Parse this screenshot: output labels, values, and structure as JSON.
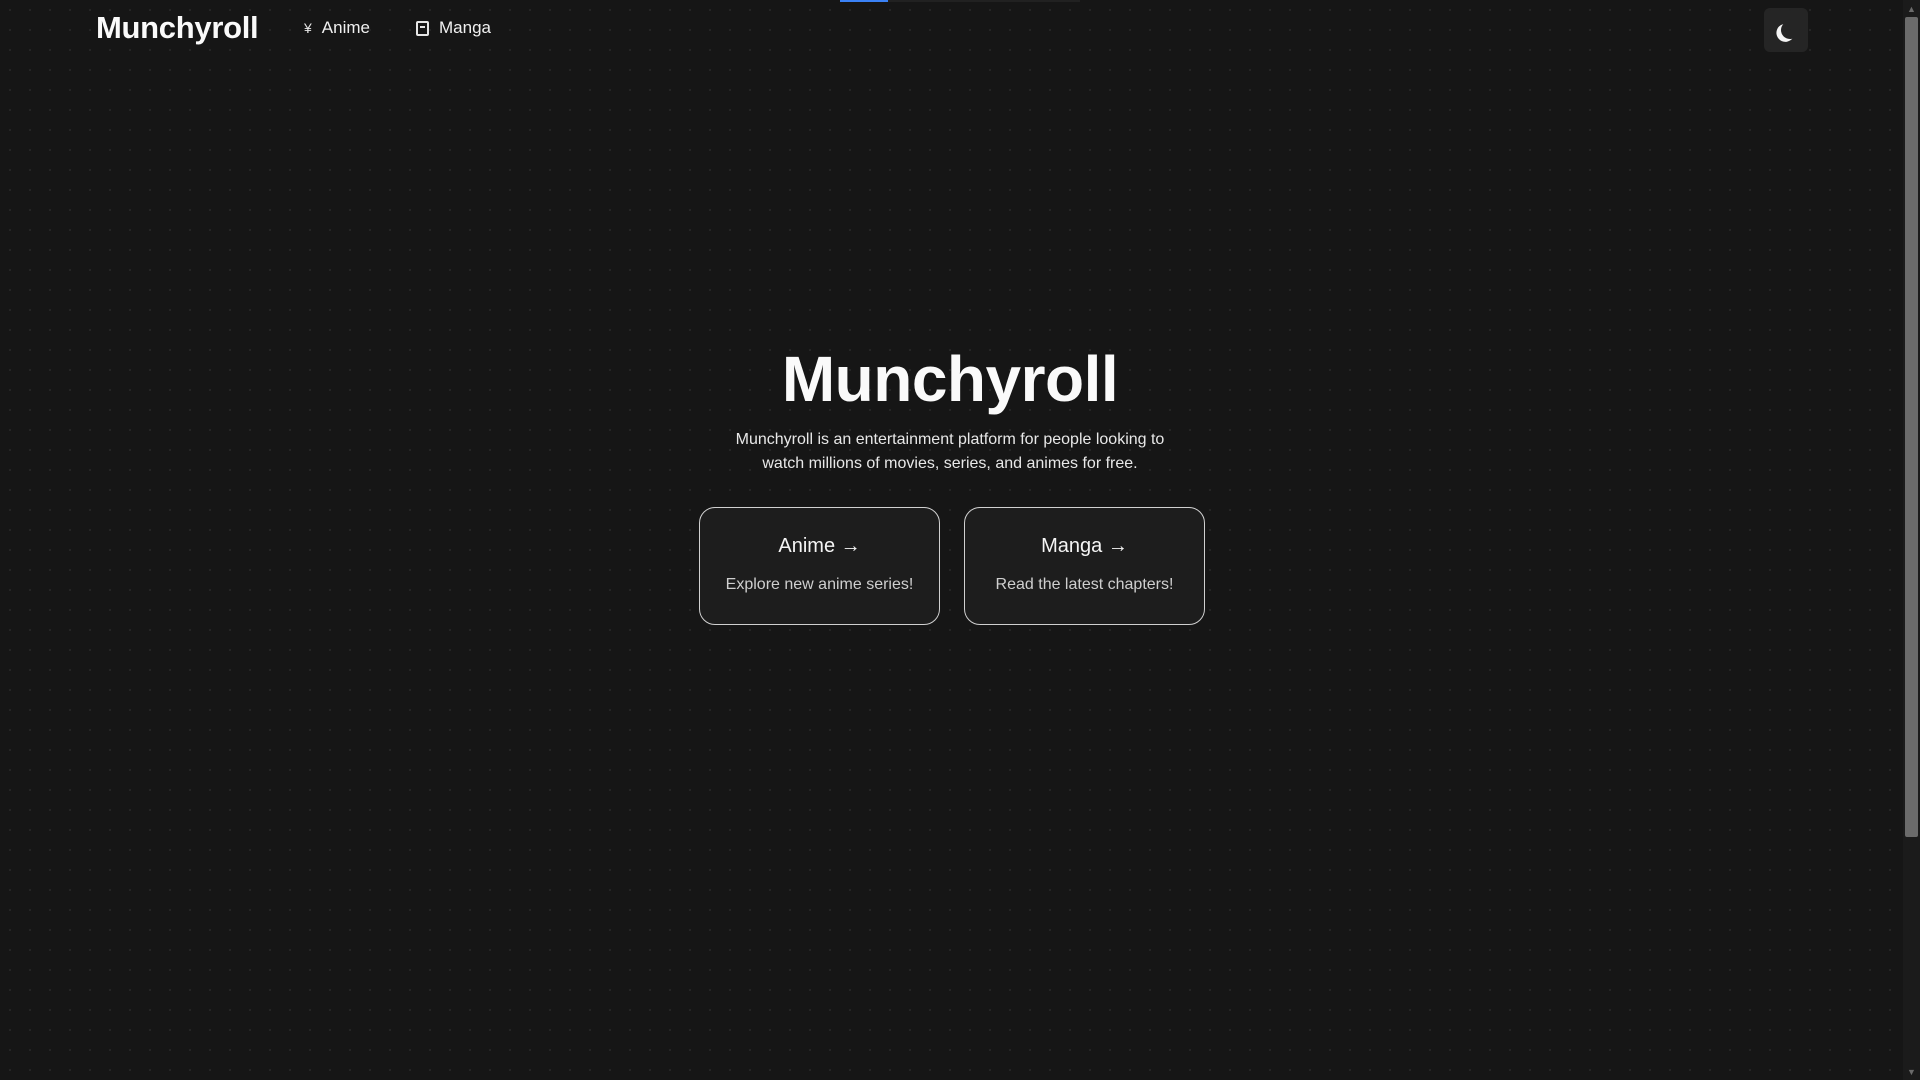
{
  "header": {
    "brand": "Munchyroll",
    "nav": [
      {
        "label": "Anime",
        "icon": "yen-icon"
      },
      {
        "label": "Manga",
        "icon": "book-icon"
      }
    ],
    "theme_toggle_icon": "moon-icon"
  },
  "hero": {
    "title": "Munchyroll",
    "description": "Munchyroll is an entertainment platform for people looking to watch millions of movies, series, and animes for free.",
    "cards": [
      {
        "title": "Anime →",
        "subtitle": "Explore new anime series!"
      },
      {
        "title": "Manga →",
        "subtitle": "Read the latest chapters!"
      }
    ]
  },
  "icons": {
    "yen": "¥",
    "scroll_up": "▲",
    "scroll_down": "▼"
  },
  "colors": {
    "background": "#161616",
    "loading_accent": "#3b82f6",
    "card_border": "#d0d0d0"
  },
  "loading_progress": 0.2
}
